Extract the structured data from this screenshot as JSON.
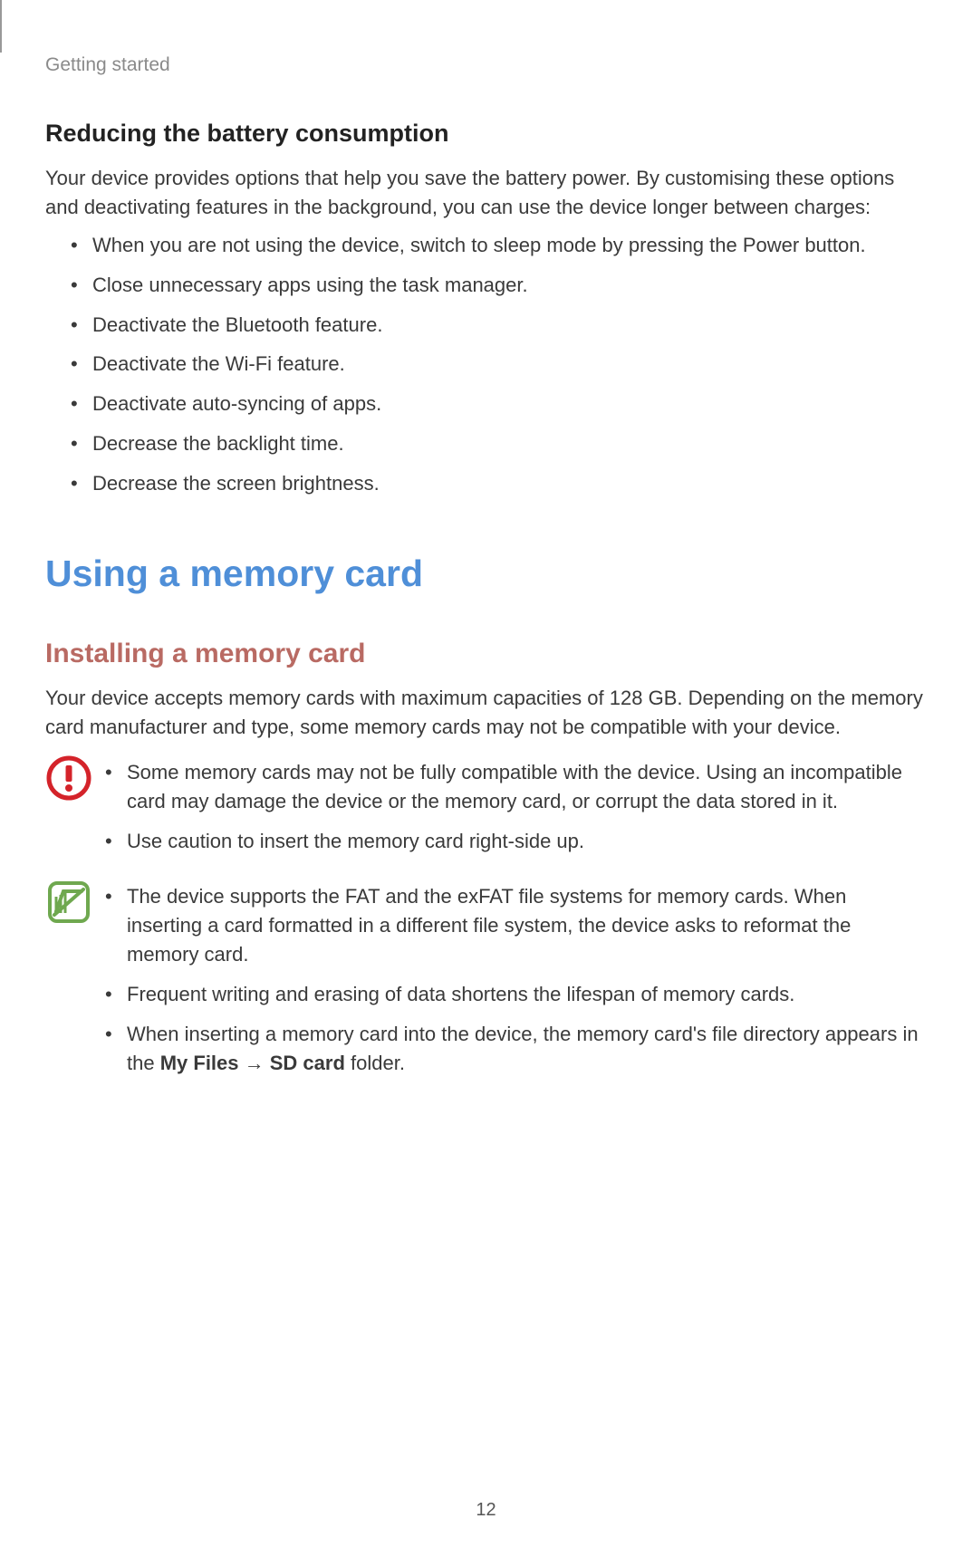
{
  "header": {
    "section": "Getting started"
  },
  "section1": {
    "title": "Reducing the battery consumption",
    "intro": "Your device provides options that help you save the battery power. By customising these options and deactivating features in the background, you can use the device longer between charges:",
    "bullets": [
      "When you are not using the device, switch to sleep mode by pressing the Power button.",
      "Close unnecessary apps using the task manager.",
      "Deactivate the Bluetooth feature.",
      "Deactivate the Wi-Fi feature.",
      "Deactivate auto-syncing of apps.",
      "Decrease the backlight time.",
      "Decrease the screen brightness."
    ]
  },
  "section2": {
    "mainTitle": "Using a memory card",
    "subTitle": "Installing a memory card",
    "intro": "Your device accepts memory cards with maximum capacities of 128 GB. Depending on the memory card manufacturer and type, some memory cards may not be compatible with your device."
  },
  "warning": {
    "bullets": [
      "Some memory cards may not be fully compatible with the device. Using an incompatible card may damage the device or the memory card, or corrupt the data stored in it.",
      "Use caution to insert the memory card right-side up."
    ]
  },
  "note": {
    "bullets": [
      "The device supports the FAT and the exFAT file systems for memory cards. When inserting a card formatted in a different file system, the device asks to reformat the memory card.",
      "Frequent writing and erasing of data shortens the lifespan of memory cards."
    ],
    "lastBullet": {
      "prefix": "When inserting a memory card into the device, the memory card's file directory appears in the ",
      "bold1": "My Files",
      "arrow": " → ",
      "bold2": "SD card",
      "suffix": " folder."
    }
  },
  "pageNumber": "12"
}
